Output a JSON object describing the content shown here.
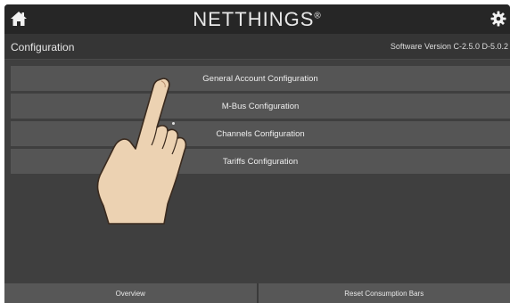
{
  "header": {
    "brand": "NETTHINGS",
    "brand_mark": "®",
    "home_icon": "home-icon",
    "settings_icon": "gear-icon"
  },
  "subheader": {
    "title": "Configuration",
    "version": "Software Version C-2.5.0 D-5.0.2"
  },
  "menu": {
    "items": [
      {
        "label": "General Account Configuration"
      },
      {
        "label": "M-Bus Configuration"
      },
      {
        "label": "Channels Configuration"
      },
      {
        "label": "Tariffs Configuration"
      }
    ]
  },
  "footer": {
    "overview_label": "Overview",
    "reset_label": "Reset Consumption Bars"
  },
  "colors": {
    "topbar": "#262626",
    "background": "#3f3f3f",
    "button": "#555555"
  }
}
